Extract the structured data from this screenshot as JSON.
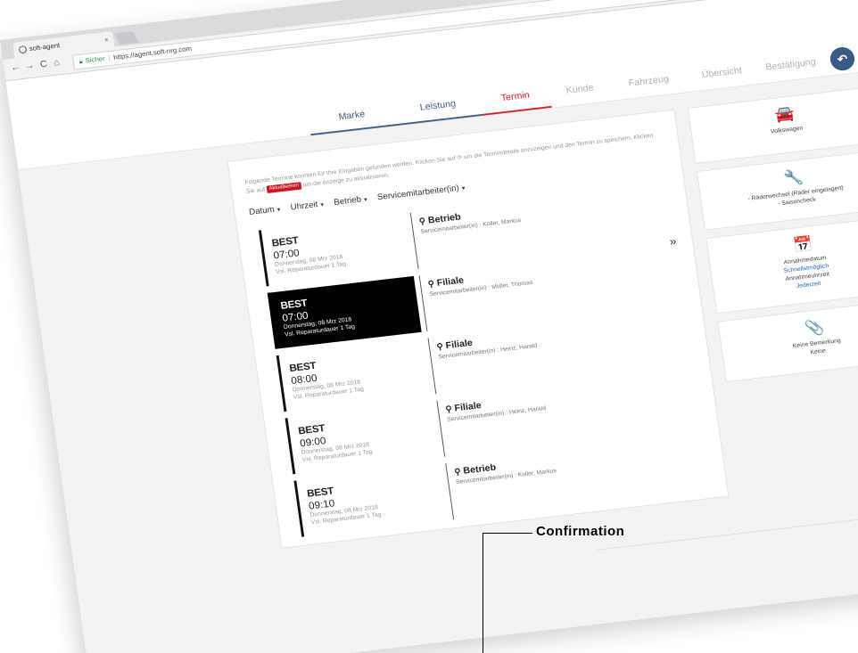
{
  "browser": {
    "tab_title": "soft-agent",
    "tab_close": "×",
    "nav_back": "←",
    "nav_forward": "→",
    "nav_reload": "C",
    "nav_home": "⌂",
    "secure_label": "Sicher",
    "url": "https://agent.soft-nrg.com"
  },
  "steps": [
    {
      "label": "Marke",
      "state": "done"
    },
    {
      "label": "Leistung",
      "state": "done"
    },
    {
      "label": "Termin",
      "state": "active"
    },
    {
      "label": "Kunde",
      "state": "todo"
    },
    {
      "label": "Fahrzeug",
      "state": "todo"
    },
    {
      "label": "Übersicht",
      "state": "todo"
    },
    {
      "label": "Bestätigung",
      "state": "todo"
    }
  ],
  "main": {
    "info_text_1": "Folgende Termine konnten für Ihre Eingaben gefunden werden. Klicken Sie auf ",
    "info_icon": "⟳",
    "info_text_2": " um die Termindetails anzuzeigen und den Termin zu speichern. Klicken Sie auf ",
    "refresh_label": "Aktualisieren",
    "info_text_3": " um die Anzeige zu aktualisieren.",
    "filters": [
      "Datum",
      "Uhrzeit",
      "Betrieb",
      "Servicemitarbeiter(in)"
    ],
    "slots": [
      {
        "title": "BEST",
        "time": "07:00",
        "date": "Donnerstag, 08 Mrz 2018",
        "duration": "Vsl. Reparaturdauer 1 Tag",
        "selected": false
      },
      {
        "title": "BEST",
        "time": "07:00",
        "date": "Donnerstag, 08 Mrz 2018",
        "duration": "Vsl. Reparaturdauer 1 Tag",
        "selected": true
      },
      {
        "title": "BEST",
        "time": "08:00",
        "date": "Donnerstag, 08 Mrz 2018",
        "duration": "Vsl. Reparaturdauer 1 Tag",
        "selected": false
      },
      {
        "title": "BEST",
        "time": "09:00",
        "date": "Donnerstag, 08 Mrz 2018",
        "duration": "Vsl. Reparaturdauer 1 Tag",
        "selected": false
      },
      {
        "title": "BEST",
        "time": "09:10",
        "date": "Donnerstag, 08 Mrz 2018",
        "duration": "Vsl. Reparaturdauer 1 Tag",
        "selected": false
      }
    ],
    "locations": [
      {
        "name": "Betrieb",
        "staff": "Servicemitarbeiter(in) :  Koller, Markus"
      },
      {
        "name": "Filiale",
        "staff": "Servicemitarbeiter(in) :  Müller, Thomas"
      },
      {
        "name": "Filiale",
        "staff": "Servicemitarbeiter(in) :  Heinz, Harald"
      },
      {
        "name": "Filiale",
        "staff": "Servicemitarbeiter(in) :  Heinz, Harald"
      },
      {
        "name": "Betrieb",
        "staff": "Servicemitarbeiter(in) :  Koller, Markus"
      }
    ],
    "next_arrow": "»",
    "pin": "⚲"
  },
  "side": {
    "vehicle": {
      "icon": "🚘",
      "text": "Volkswagen"
    },
    "service": {
      "icon": "🔧",
      "line1": "- Räderwechsel (Räder eingelagert)",
      "line2": "- Saisoncheck"
    },
    "appointment": {
      "icon": "📅",
      "line1": "Annahmedatum",
      "link1": "Schnellstmöglich",
      "line2": "Annahmeuhrzeit",
      "link2": "Jederzeit"
    },
    "notes": {
      "icon": "📎",
      "line1": "Keine Bemerkung",
      "line2": "Keine"
    }
  },
  "footer": {
    "icon": "⊕"
  },
  "callout": {
    "label": "Confirmation"
  }
}
